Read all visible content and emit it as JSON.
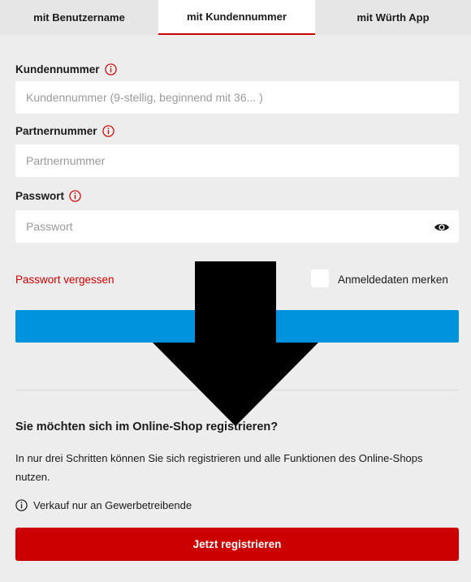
{
  "tabs": [
    {
      "label": "mit Benutzername",
      "active": false
    },
    {
      "label": "mit Kundennummer",
      "active": true
    },
    {
      "label": "mit Würth App",
      "active": false
    }
  ],
  "form": {
    "customer_number": {
      "label": "Kundennummer",
      "placeholder": "Kundennummer (9-stellig, beginnend mit 36... )",
      "value": ""
    },
    "partner_number": {
      "label": "Partnernummer",
      "placeholder": "Partnernummer",
      "value": ""
    },
    "password": {
      "label": "Passwort",
      "placeholder": "Passwort",
      "value": ""
    },
    "forgot_password": "Passwort vergessen",
    "remember_me": {
      "label": "Anmeldedaten merken",
      "checked": false
    },
    "login_button": ""
  },
  "registration": {
    "title": "Sie möchten sich im Online-Shop registrieren?",
    "text": "In nur drei Schritten können Sie sich registrieren und alle Funktionen des Online-Shops nutzen.",
    "notice": "Verkauf nur an Gewerbetreibende",
    "button": "Jetzt registrieren"
  },
  "colors": {
    "accent_red": "#cc0000",
    "login_blue": "#0093dd",
    "panel_bg": "#ededed",
    "overlay_arrow": "#000000"
  },
  "icons": {
    "info": "info-circle-icon",
    "eye": "eye-icon",
    "overlay": "down-arrow-overlay"
  }
}
